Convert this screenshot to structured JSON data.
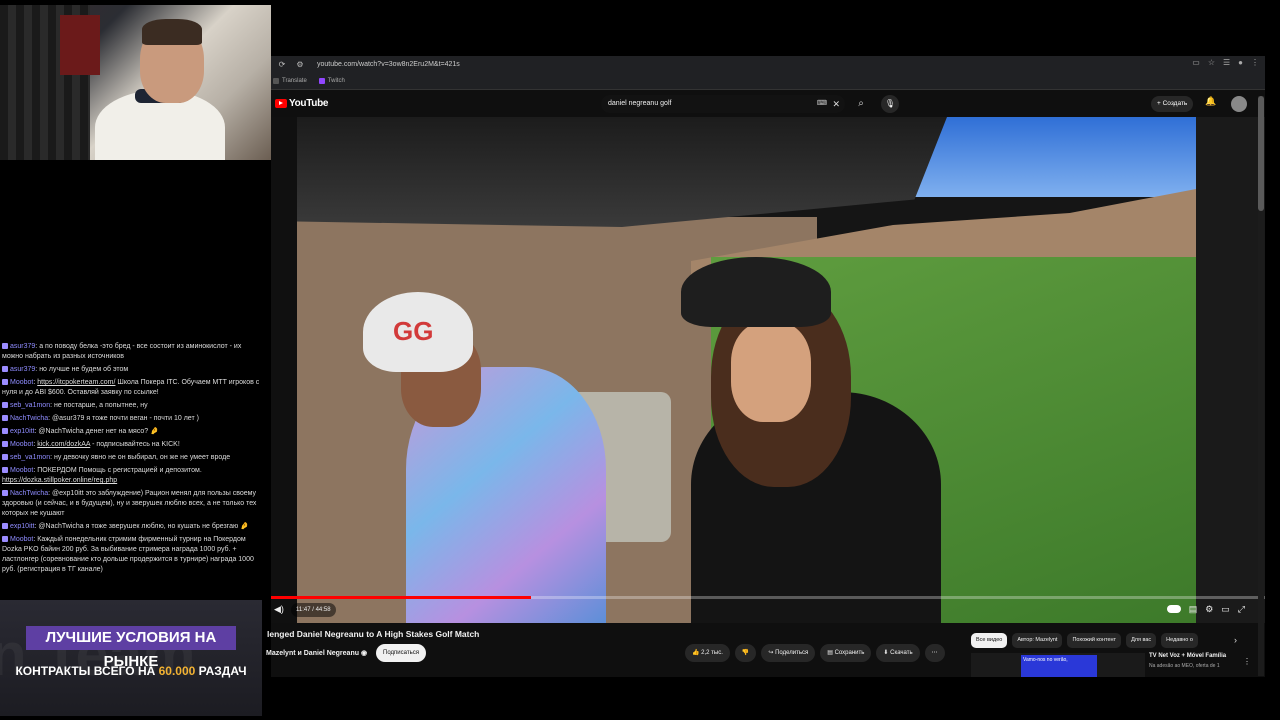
{
  "browser": {
    "url": "youtube.com/watch?v=3ow8n2Eru2M&t=421s",
    "bookmarks": [
      "Translate",
      "Twitch"
    ]
  },
  "youtube": {
    "logo": "YouTube",
    "search_query": "daniel negreanu golf",
    "create_label": "Создать",
    "video": {
      "time": "11:47 / 44:58",
      "progress": 0.262,
      "title": "lenged Daniel Negreanu to A High Stakes Golf Match",
      "channel": "Mazelynt и Daniel Negreanu",
      "subscribe_label": "Подписаться",
      "actions": {
        "likes": "2,2 тыс.",
        "share": "Поделиться",
        "save": "Сохранить",
        "download": "Скачать"
      }
    },
    "chips": [
      "Все видео",
      "Автор: Mazelynt",
      "Похожий контент",
      "Для вас",
      "Недавно о"
    ],
    "recommendation": {
      "title": "TV Net Voz + Móvel Família",
      "meta": "Na adesão ao MEO, oferta de 1",
      "thumb_text": "Vamo-nos no verão,"
    }
  },
  "chat": [
    {
      "user": "asur379",
      "text": "а по поводу белка -это бред - все состоит из аминокислот - их можно набрать из разных источников"
    },
    {
      "user": "asur379",
      "text": "но лучше не будем об этом"
    },
    {
      "user": "Moobot",
      "link": "https://itcpokerteam.com/",
      "text": "Школа Покера ITC. Обучаем МТТ игроков с нуля и до ABI $600. Оставляй заявку по ссылке!"
    },
    {
      "user": "seb_va1mon",
      "text": "не постарше, а попытнее, ну"
    },
    {
      "user": "NachTwicha",
      "text": "@asur379 я тоже почти веган - почти 10 лет )"
    },
    {
      "user": "exp10itt",
      "text": "@NachTwicha денег нет на мясо? 🤌"
    },
    {
      "user": "Moobot",
      "link": "kick.com/dozkAA",
      "text": "- подписывайтесь на KICK!"
    },
    {
      "user": "seb_va1mon",
      "text": "ну девочку явно не он выбирал, он же не умеет вроде"
    },
    {
      "user": "Moobot",
      "text": "ПОКЕРДОМ Помощь с регистрацией и депозитом.",
      "link2": "https://dozka.stillpoker.online/reg.php"
    },
    {
      "user": "NachTwicha",
      "text": "@exp10itt это заблуждение) Рацион менял для пользы своему здоровью (и сейчас, и в будущем), ну и зверушек люблю всех, а не только тех которых не кушают"
    },
    {
      "user": "exp10itt",
      "text": "@NachTwicha я тоже зверушек люблю, но кушать не брезгаю 🤌"
    },
    {
      "user": "Moobot",
      "text": "Каждый понедельник стримим фирменный турнир на Покердом Dozka PKO байин 200 руб. За выбивание стримера награда 1000 руб. + ластлонгер (соревнование кто дольше продержится в турнире) награда 1000 руб. (регистрация в ТГ канале)"
    }
  ],
  "promo": {
    "headline": "ЛУЧШИЕ УСЛОВИЯ НА РЫНКЕ",
    "sub_prefix": "КОНТРАКТЫ ВСЕГО НА",
    "sub_highlight": "60.000",
    "sub_suffix": "РАЗДАЧ",
    "watermark": "n Team"
  },
  "colors": {
    "yt_red": "#ff0000",
    "chat_username": "#8f8cff",
    "promo_headline_bg": "#5e3fa3",
    "promo_highlight": "#f2b233"
  }
}
